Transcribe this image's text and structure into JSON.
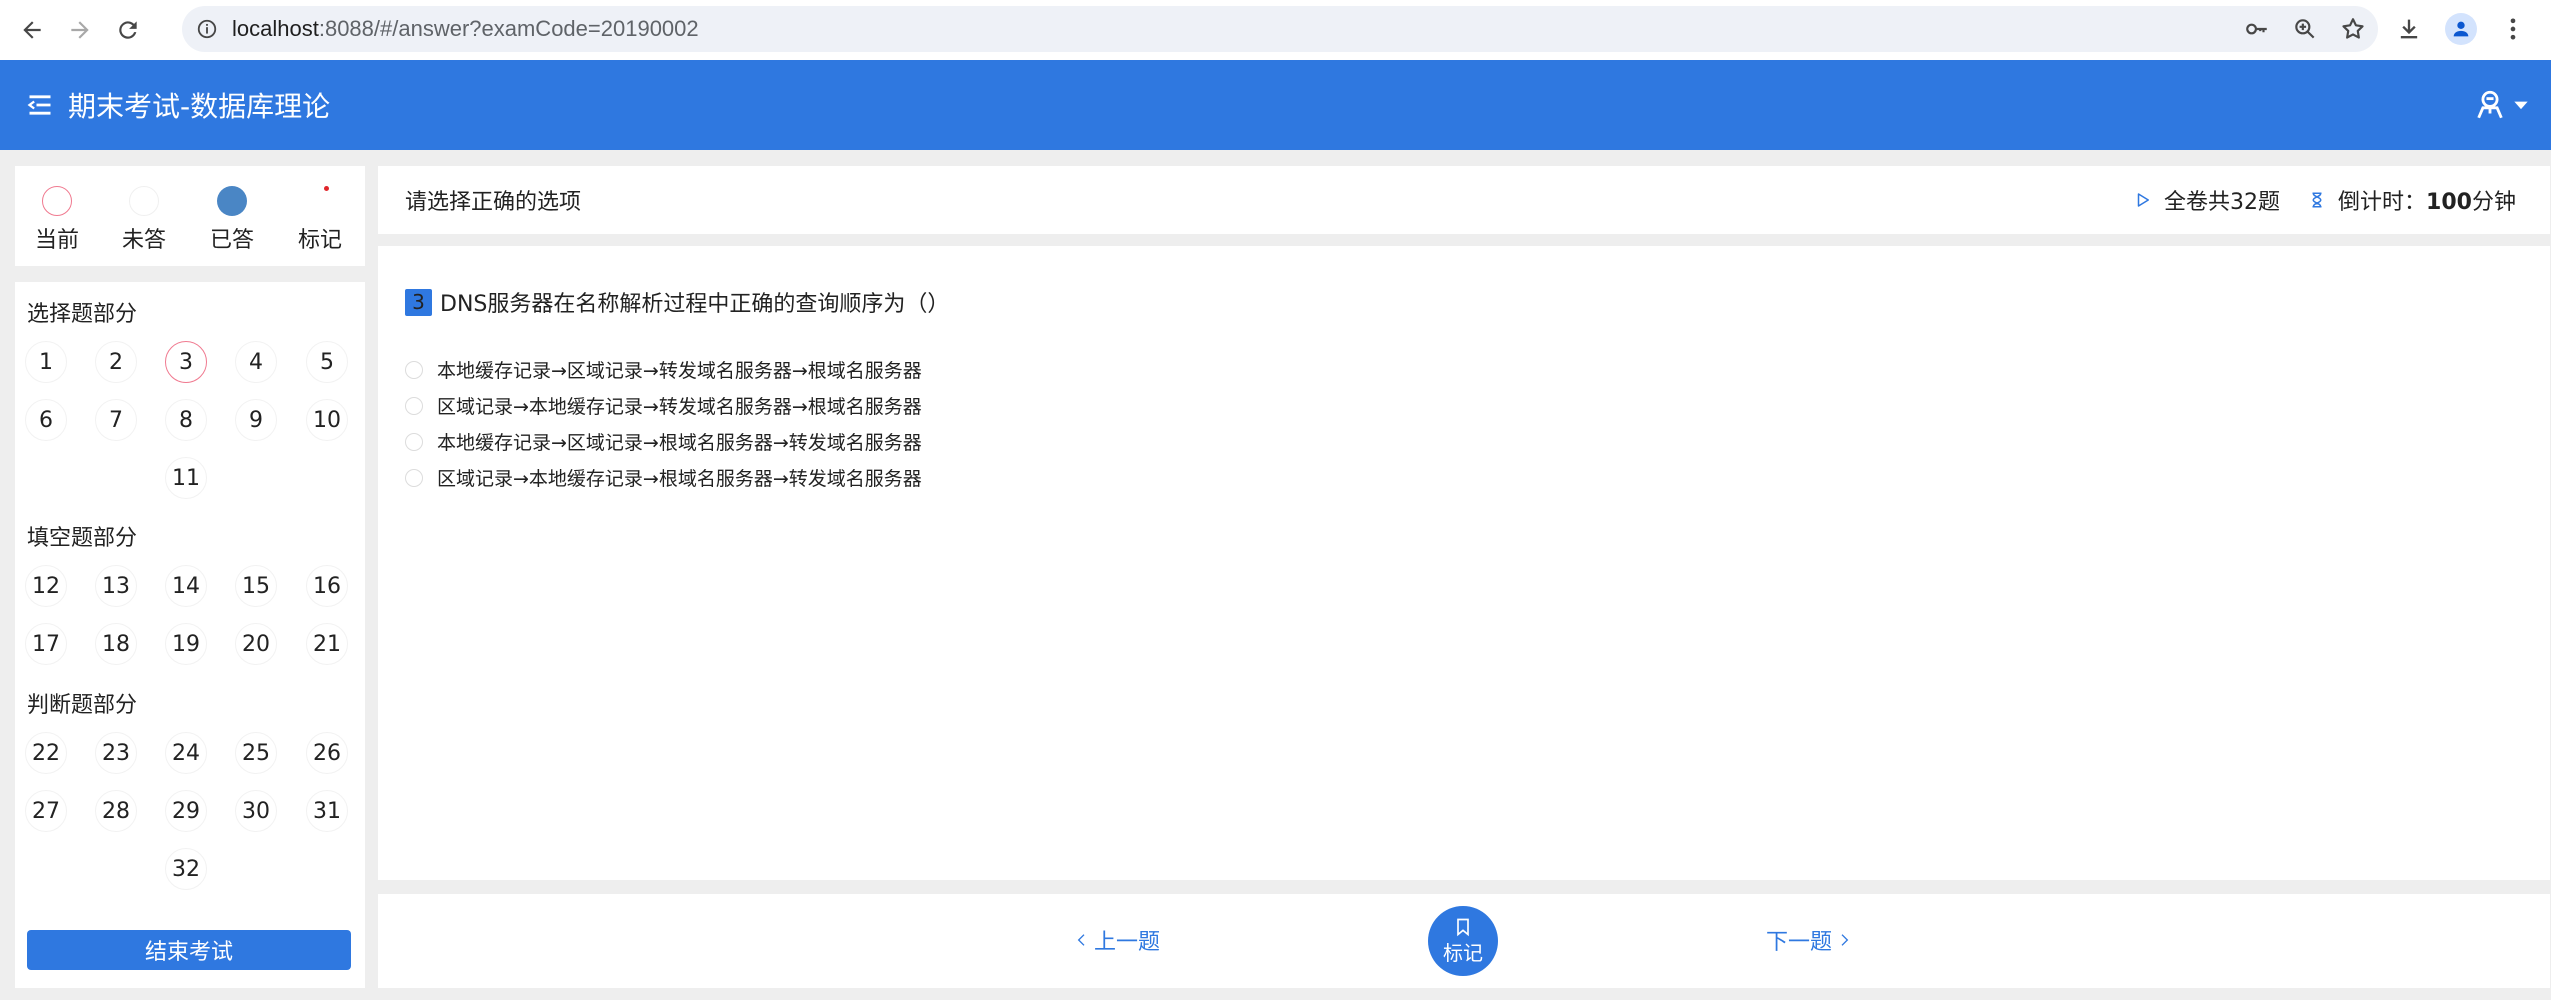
{
  "browser": {
    "url_host": "localhost",
    "url_rest": ":8088/#/answer?examCode=20190002"
  },
  "header": {
    "title": "期末考试-数据库理论"
  },
  "legend": [
    {
      "label": "当前",
      "color": "#f07a90",
      "style": "ring"
    },
    {
      "label": "未答",
      "color": "#f0f0f0",
      "style": "ring"
    },
    {
      "label": "已答",
      "color": "#4a86c5",
      "style": "fill"
    },
    {
      "label": "标记",
      "color": "#e0262b",
      "style": "dot"
    }
  ],
  "sections": [
    {
      "title": "选择题部分",
      "numbers": [
        "1",
        "2",
        "3",
        "4",
        "5",
        "6",
        "7",
        "8",
        "9",
        "10",
        "11"
      ]
    },
    {
      "title": "填空题部分",
      "numbers": [
        "12",
        "13",
        "14",
        "15",
        "16",
        "17",
        "18",
        "19",
        "20",
        "21"
      ]
    },
    {
      "title": "判断题部分",
      "numbers": [
        "22",
        "23",
        "24",
        "25",
        "26",
        "27",
        "28",
        "29",
        "30",
        "31",
        "32"
      ]
    }
  ],
  "current_question": "3",
  "end_exam_label": "结束考试",
  "infobar": {
    "instruction": "请选择正确的选项",
    "total": "全卷共32题",
    "timer_label": "倒计时：",
    "timer_value": "100",
    "timer_unit": "分钟"
  },
  "question": {
    "number": "3",
    "text": "DNS服务器在名称解析过程中正确的查询顺序为（）",
    "options": [
      "本地缓存记录→区域记录→转发域名服务器→根域名服务器",
      "区域记录→本地缓存记录→转发域名服务器→根域名服务器",
      "本地缓存记录→区域记录→根域名服务器→转发域名服务器",
      "区域记录→本地缓存记录→根域名服务器→转发域名服务器"
    ]
  },
  "nav": {
    "prev_label": "上一题",
    "mark_label": "标记",
    "next_label": "下一题"
  },
  "colors": {
    "primary": "#2f78e0",
    "current_ring": "#f07a90"
  }
}
